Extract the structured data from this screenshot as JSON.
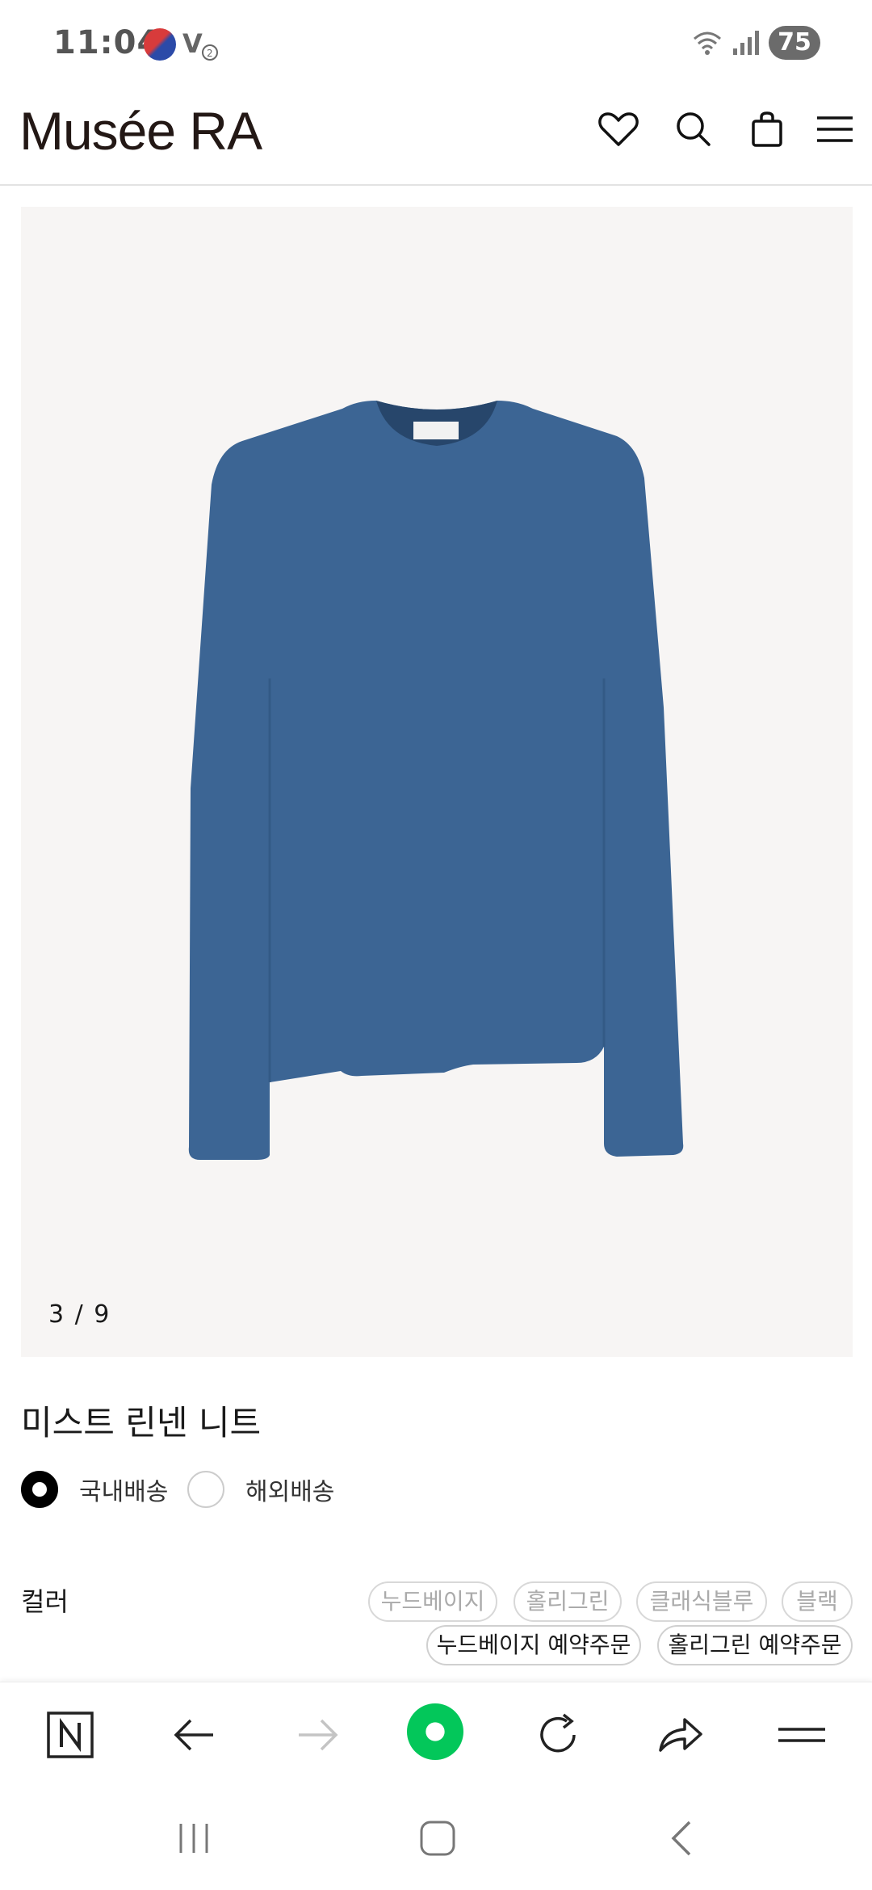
{
  "status_bar": {
    "time": "11:04",
    "battery": "75"
  },
  "header": {
    "logo": "Musée RA"
  },
  "gallery": {
    "counter": "3 / 9",
    "product_color": "#3c6594"
  },
  "product": {
    "title": "미스트 린넨 니트",
    "shipping": [
      {
        "label": "국내배송",
        "selected": true
      },
      {
        "label": "해외배송",
        "selected": false
      }
    ]
  },
  "options": {
    "color_label": "컬러",
    "chips_row1": [
      "누드베이지",
      "홀리그린",
      "클래식블루",
      "블랙"
    ],
    "chips_row2": [
      "누드베이지 예약주문",
      "홀리그린 예약주문"
    ]
  },
  "colors": {
    "accent_green": "#03c75a",
    "text": "#1a1a1a",
    "gallery_bg": "#f7f5f4"
  }
}
